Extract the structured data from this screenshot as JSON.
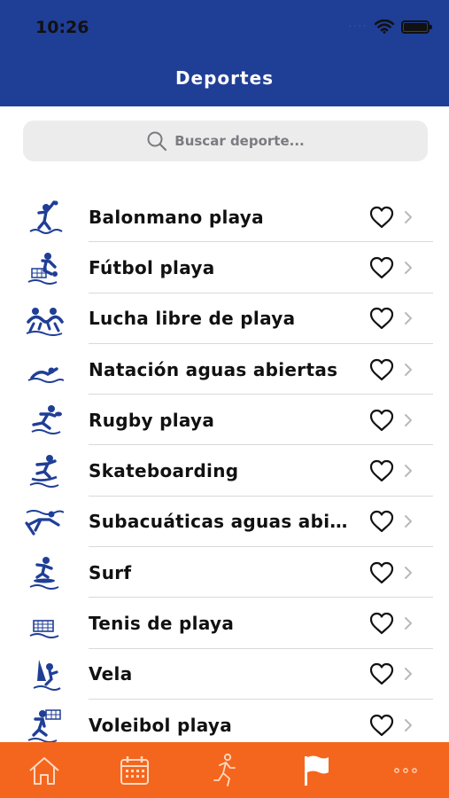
{
  "status": {
    "time": "10:26"
  },
  "header": {
    "title": "Deportes"
  },
  "search": {
    "placeholder": "Buscar deporte..."
  },
  "sports": [
    {
      "label": "Balonmano playa",
      "icon": "handball-icon"
    },
    {
      "label": "Fútbol playa",
      "icon": "beach-soccer-icon"
    },
    {
      "label": "Lucha libre de playa",
      "icon": "wrestling-icon"
    },
    {
      "label": "Natación aguas abiertas",
      "icon": "swimming-icon"
    },
    {
      "label": "Rugby playa",
      "icon": "rugby-icon"
    },
    {
      "label": "Skateboarding",
      "icon": "skateboarding-icon"
    },
    {
      "label": "Subacuáticas aguas abiertas",
      "icon": "underwater-icon"
    },
    {
      "label": "Surf",
      "icon": "surf-icon"
    },
    {
      "label": "Tenis de playa",
      "icon": "beach-tennis-icon"
    },
    {
      "label": "Vela",
      "icon": "sailing-icon"
    },
    {
      "label": "Voleibol playa",
      "icon": "volleyball-icon"
    }
  ],
  "tabbar": {
    "tabs": [
      {
        "icon": "home-icon",
        "active": false
      },
      {
        "icon": "calendar-icon",
        "active": false
      },
      {
        "icon": "runner-icon",
        "active": false
      },
      {
        "icon": "flag-icon",
        "active": true
      },
      {
        "icon": "more-icon",
        "active": false
      }
    ]
  },
  "colors": {
    "header": "#1f3e96",
    "tabbar": "#f4661e",
    "icon": "#1f3e96"
  }
}
